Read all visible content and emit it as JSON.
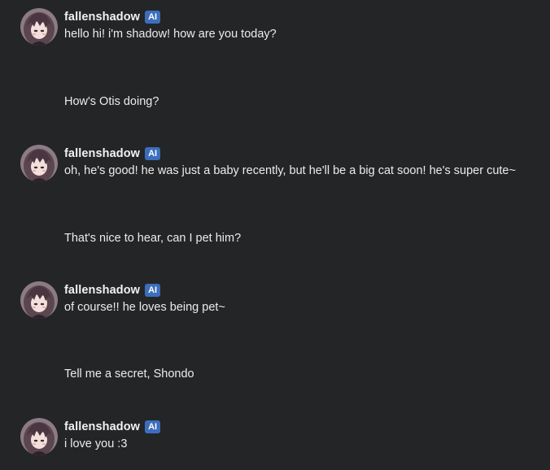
{
  "chat": {
    "ai_name": "fallenshadow",
    "ai_badge": "AI",
    "messages": [
      {
        "role": "ai",
        "text": "hello hi! i'm shadow! how are you today?"
      },
      {
        "role": "user",
        "text": "How's Otis doing?"
      },
      {
        "role": "ai",
        "text": "oh, he's good! he was just a baby recently, but he'll be a big cat soon! he's super cute~"
      },
      {
        "role": "user",
        "text": "That's nice to hear, can I pet him?"
      },
      {
        "role": "ai",
        "text": "of course!! he loves being pet~"
      },
      {
        "role": "user",
        "text": "Tell me a secret, Shondo"
      },
      {
        "role": "ai",
        "text": "i love you :3"
      }
    ]
  },
  "colors": {
    "background": "#232527",
    "text": "#ececec",
    "badge": "#3d6ebd"
  },
  "icons": {
    "avatar": "anime-girl-avatar-icon"
  }
}
